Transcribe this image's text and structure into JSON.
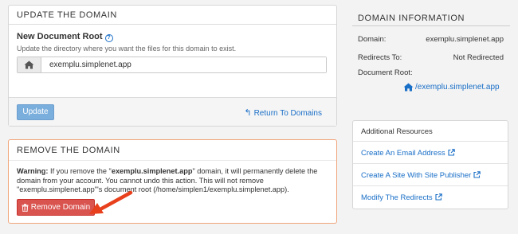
{
  "update_panel": {
    "title": "UPDATE THE DOMAIN",
    "field_label": "New Document Root",
    "field_description": "Update the directory where you want the files for this domain to exist.",
    "docroot_value": "exemplu.simplenet.app",
    "update_button": "Update",
    "return_link": "Return To Domains"
  },
  "remove_panel": {
    "title": "REMOVE THE DOMAIN",
    "warning_label": "Warning:",
    "warning_part1": " If you remove the \"",
    "warning_domain": "exemplu.simplenet.app",
    "warning_part2": "\" domain, it will permanently delete the domain from your account. You cannot undo this action. This will not remove \"exemplu.simplenet.app\"'s document root (/home/simplen1/exemplu.simplenet.app).",
    "remove_button": "Remove Domain"
  },
  "domain_info": {
    "title": "DOMAIN INFORMATION",
    "domain_label": "Domain:",
    "domain_value": "exemplu.simplenet.app",
    "redirects_label": "Redirects To:",
    "redirects_value": "Not Redirected",
    "docroot_label": "Document Root:",
    "docroot_value": "/exemplu.simplenet.app"
  },
  "resources": {
    "title": "Additional Resources",
    "items": [
      "Create An Email Address",
      "Create A Site With Site Publisher",
      "Modify The Redirects"
    ]
  },
  "colors": {
    "link": "#1a6fc7",
    "danger": "#d9534f",
    "annotation_arrow": "#e8401c",
    "primary_disabled": "#7aaedc"
  }
}
